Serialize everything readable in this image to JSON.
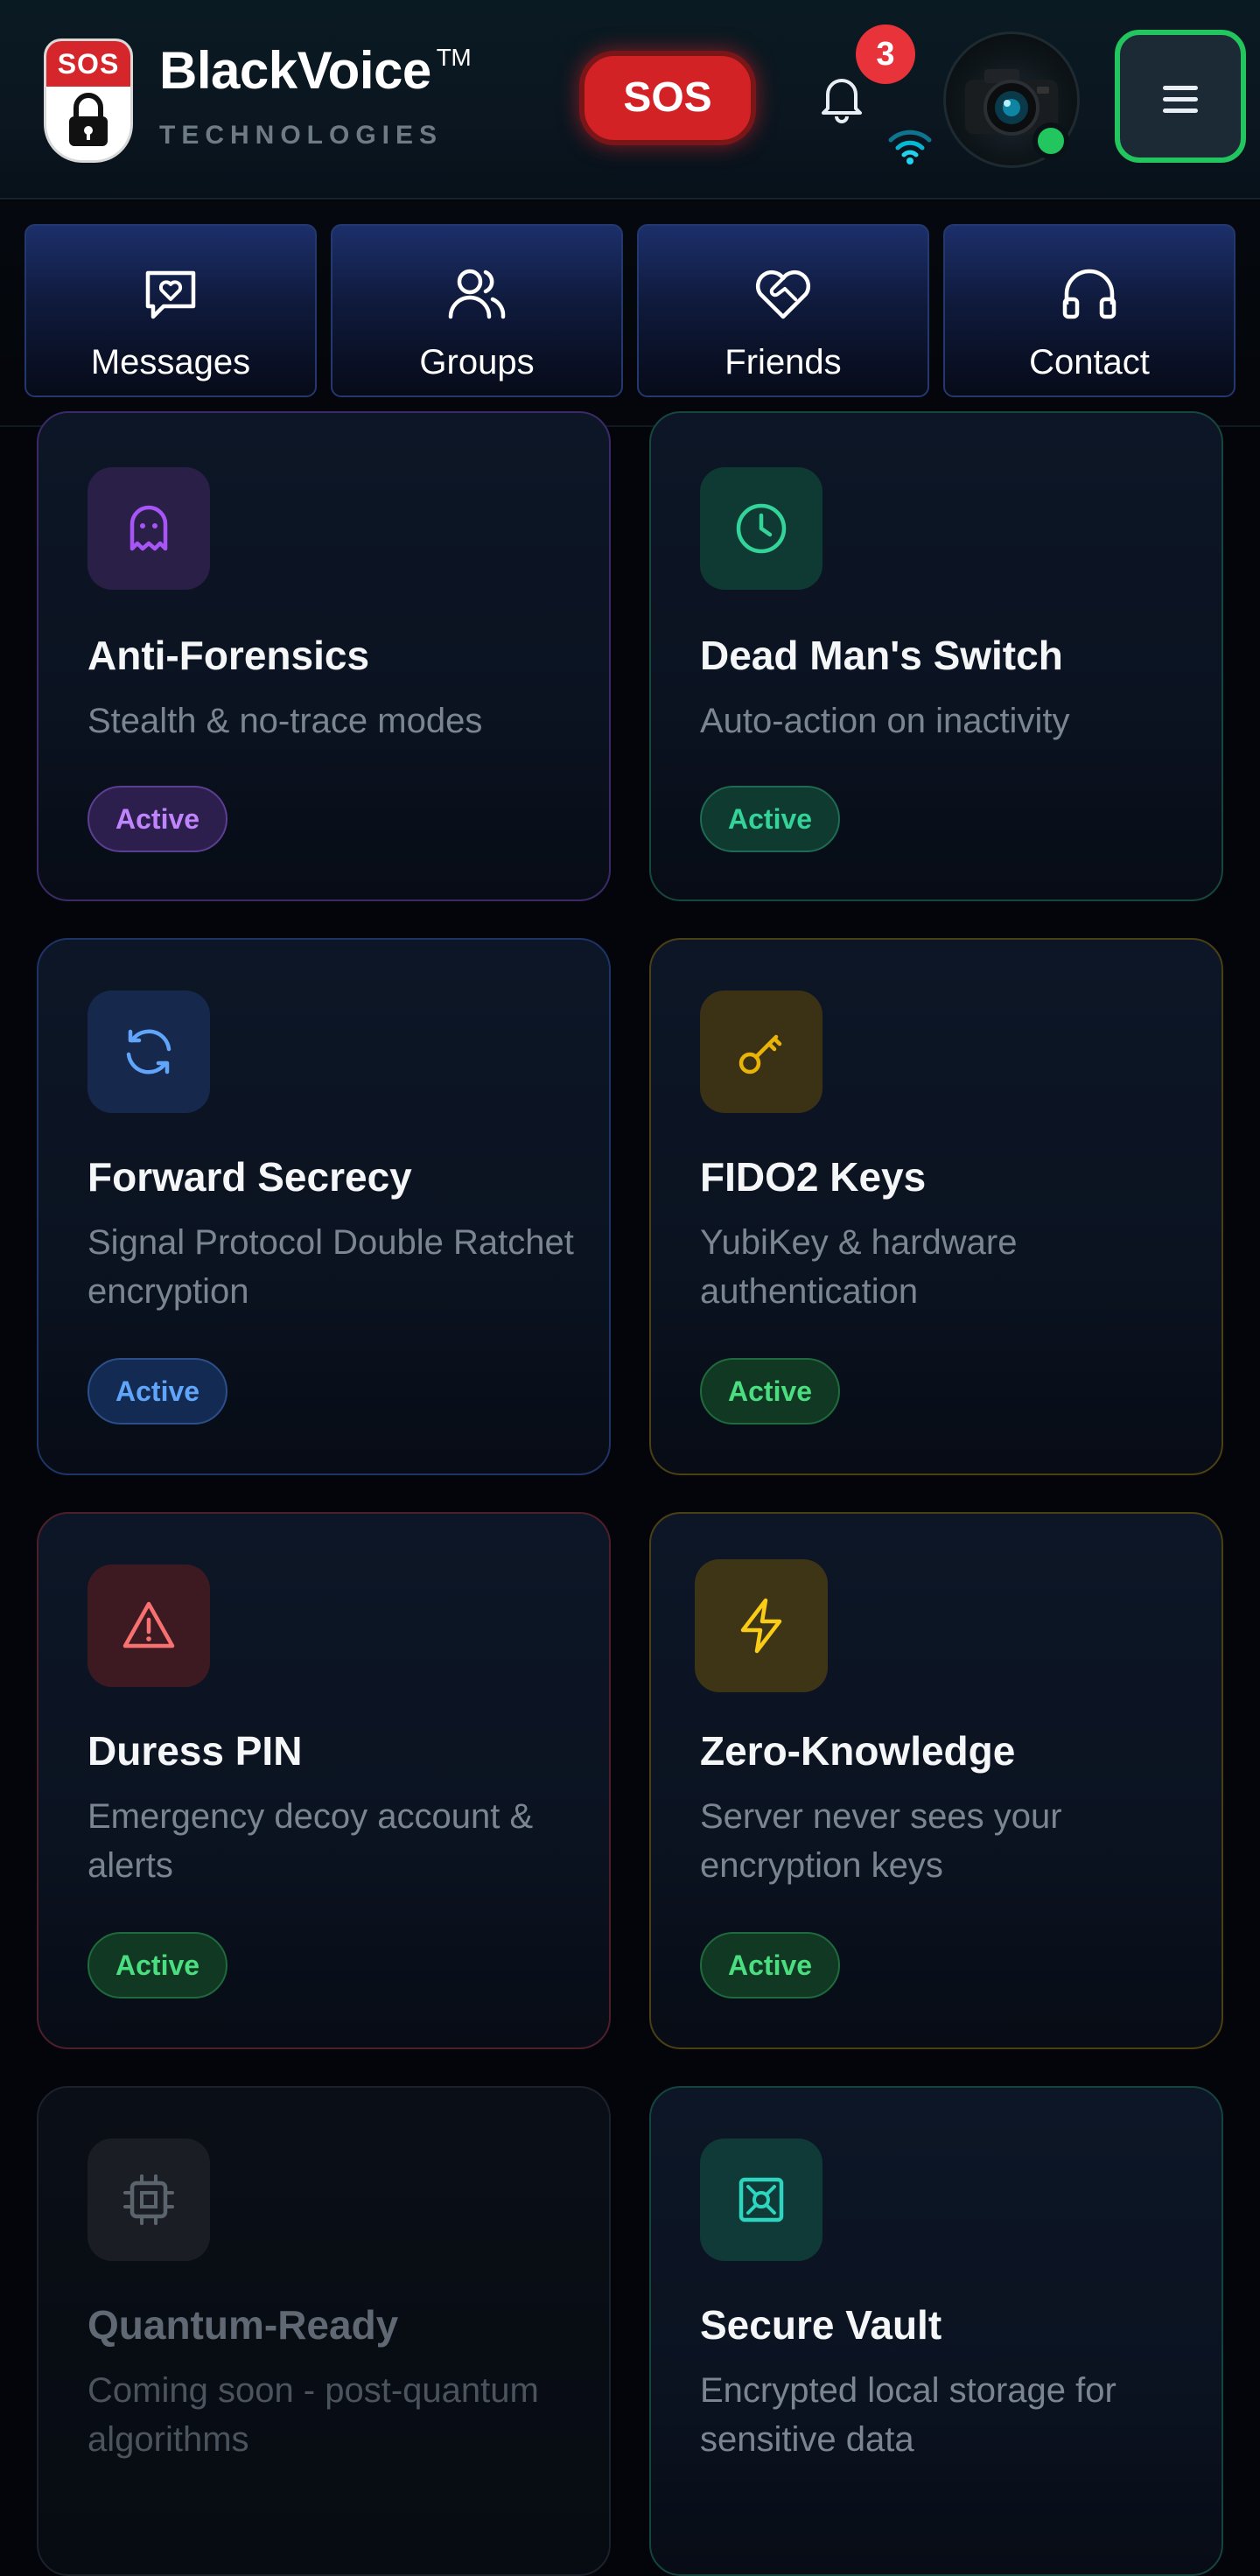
{
  "header": {
    "logo_badge": "SOS",
    "brand_name": "BlackVoice",
    "trademark": "TM",
    "brand_subtitle": "TECHNOLOGIES",
    "sos_label": "SOS",
    "notification_count": "3"
  },
  "nav": {
    "items": [
      {
        "label": "Messages"
      },
      {
        "label": "Groups"
      },
      {
        "label": "Friends"
      },
      {
        "label": "Contact"
      }
    ]
  },
  "features": [
    {
      "title": "Anti-Forensics",
      "desc": "Stealth & no-trace modes",
      "status": "Active",
      "accent": "#a855f7"
    },
    {
      "title": "Dead Man's Switch",
      "desc": "Auto-action on inactivity",
      "status": "Active",
      "accent": "#34d399"
    },
    {
      "title": "Forward Secrecy",
      "desc": "Signal Protocol Double Ratchet encryption",
      "status": "Active",
      "accent": "#60a5fa"
    },
    {
      "title": "FIDO2 Keys",
      "desc": "YubiKey & hardware authentication",
      "status": "Active",
      "accent": "#eab308"
    },
    {
      "title": "Duress PIN",
      "desc": "Emergency decoy account & alerts",
      "status": "Active",
      "accent": "#f87171"
    },
    {
      "title": "Zero-Knowledge",
      "desc": "Server never sees your encryption keys",
      "status": "Active",
      "accent": "#facc15"
    },
    {
      "title": "Quantum-Ready",
      "desc": "Coming soon - post-quantum algorithms",
      "status": "",
      "accent": "#6b7280"
    },
    {
      "title": "Secure Vault",
      "desc": "Encrypted local storage for sensitive data",
      "status": "",
      "accent": "#2dd4bf"
    }
  ],
  "colors": {
    "online": "#22c55e",
    "sos": "#d22226",
    "active_green": "#4ade80"
  }
}
